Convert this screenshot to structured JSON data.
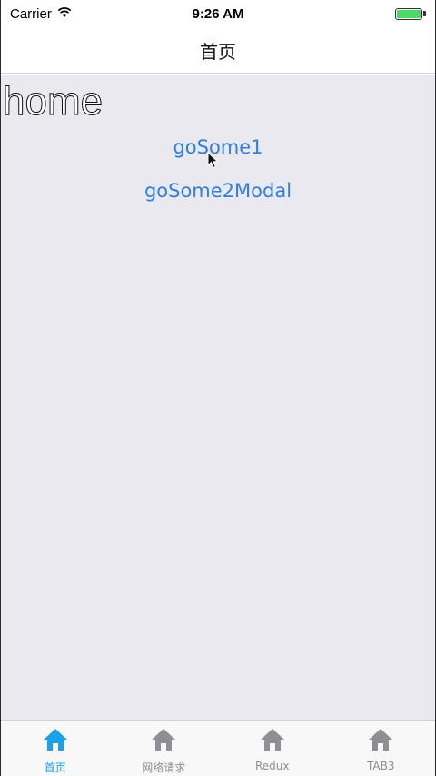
{
  "status_bar": {
    "carrier": "Carrier",
    "time": "9:26 AM",
    "battery_color": "#4cd964"
  },
  "nav": {
    "title": "首页"
  },
  "content": {
    "heading": "home",
    "links": [
      {
        "label": "goSome1"
      },
      {
        "label": "goSome2Modal"
      }
    ],
    "link_color": "#2f7ee0",
    "background": "#e9e9ef"
  },
  "tab_bar": {
    "active_color": "#1aa1e6",
    "inactive_color": "#8e8e93",
    "tabs": [
      {
        "label": "首页",
        "icon": "home-icon",
        "active": true
      },
      {
        "label": "网络请求",
        "icon": "home-icon",
        "active": false
      },
      {
        "label": "Redux",
        "icon": "home-icon",
        "active": false
      },
      {
        "label": "TAB3",
        "icon": "home-icon",
        "active": false
      }
    ]
  }
}
